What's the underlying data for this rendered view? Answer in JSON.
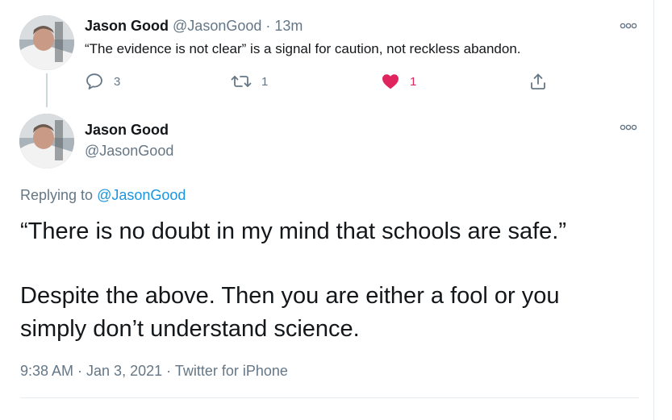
{
  "parent_tweet": {
    "display_name": "Jason Good",
    "handle": "@JasonGood",
    "separator": "·",
    "time_ago": "13m",
    "text": "“The evidence is not clear” is a signal for caution, not reckless abandon.",
    "reply_count": "3",
    "retweet_count": "1",
    "like_count": "1",
    "like_color": "#e0245e"
  },
  "main_tweet": {
    "display_name": "Jason Good",
    "handle": "@JasonGood",
    "replying_prefix": "Replying to",
    "replying_to": "@JasonGood",
    "body_line_1": "“There is no doubt in my mind that schools are safe.”",
    "body_line_2": "Despite the above. Then you are either a fool or you",
    "body_line_3": "simply don’t understand science.",
    "timestamp": "9:38 AM · Jan 3, 2021",
    "meta_separator": "·",
    "source": "Twitter for iPhone"
  },
  "colors": {
    "link": "#1b95e0",
    "muted": "#657786",
    "text": "#14171a"
  },
  "icons": [
    "reply-icon",
    "retweet-icon",
    "heart-icon",
    "share-icon",
    "more-icon"
  ]
}
